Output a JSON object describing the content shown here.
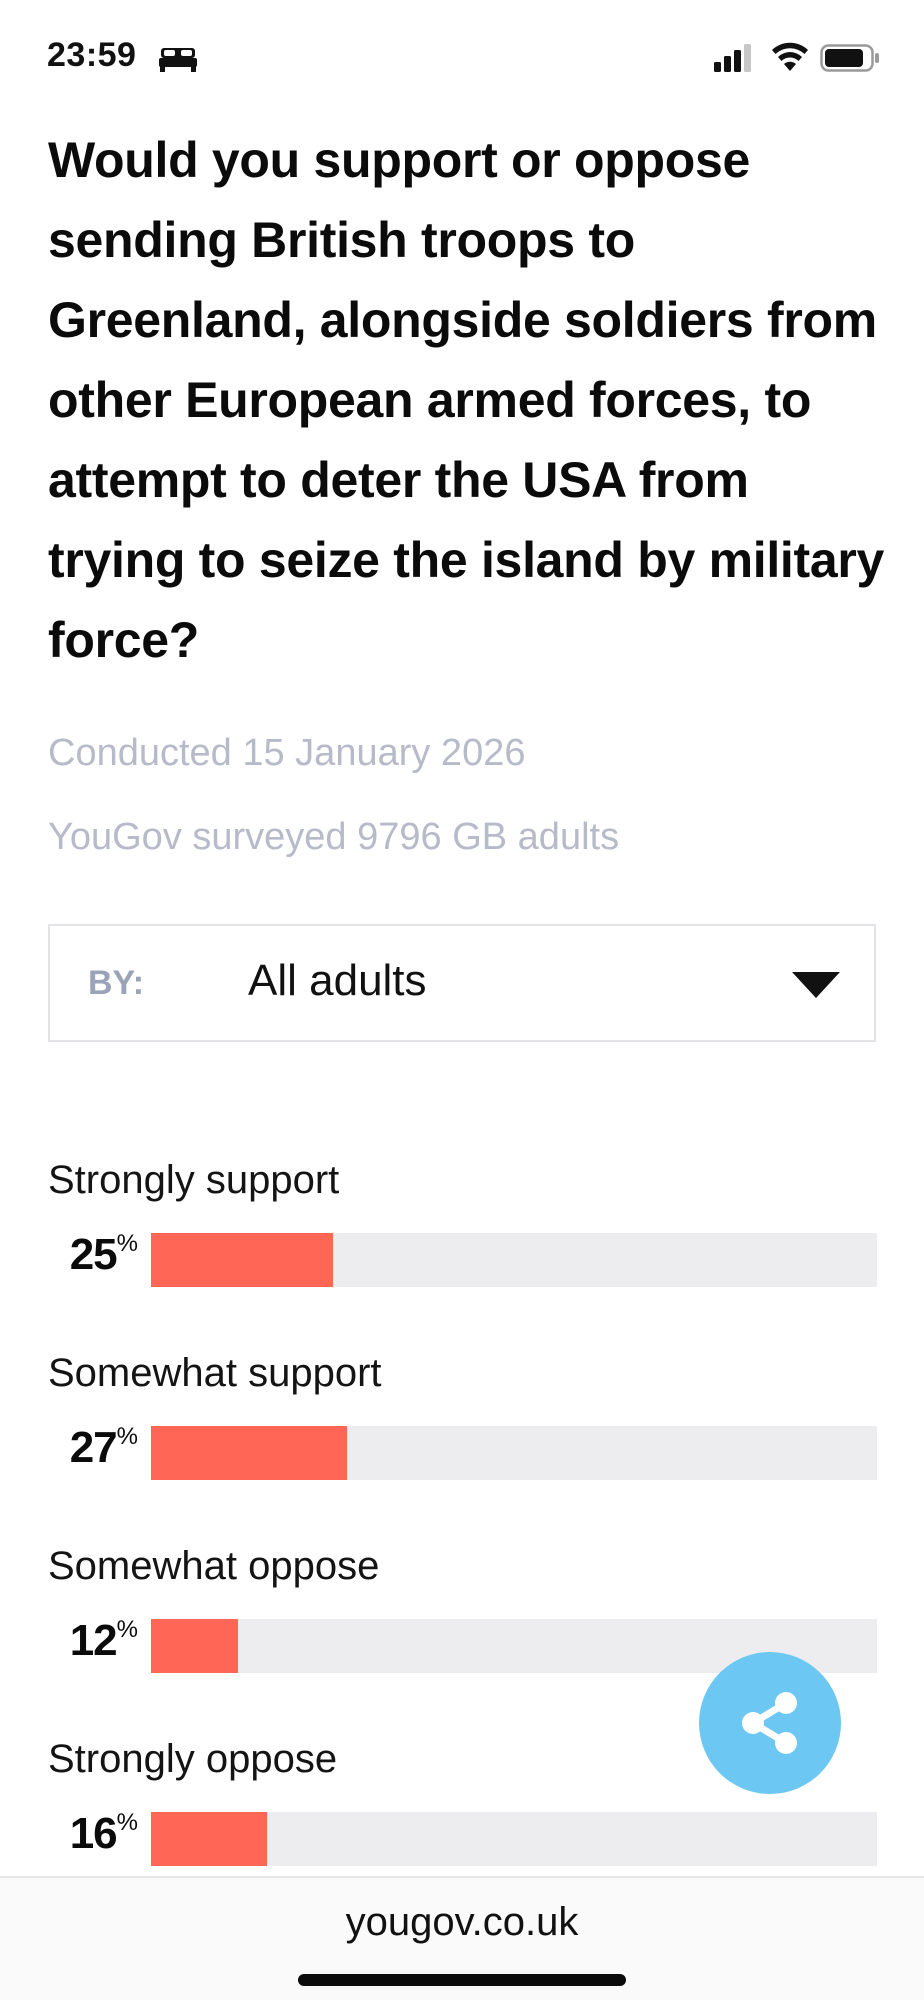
{
  "status_bar": {
    "time": "23:59",
    "icons": [
      "bed-icon",
      "signal-icon",
      "wifi-icon",
      "battery-icon"
    ]
  },
  "question": "Would you support or oppose sending British troops to Greenland, alongside soldiers from other European armed forces, to attempt to deter the USA from trying to seize the island by military force?",
  "conducted": "Conducted 15 January 2026",
  "sample": "YouGov surveyed 9796 GB adults",
  "filter": {
    "label": "BY:",
    "selected": "All adults",
    "icon": "caret-down-icon"
  },
  "chart_data": {
    "type": "bar",
    "categories": [
      "Strongly support",
      "Somewhat support",
      "Somewhat oppose",
      "Strongly oppose"
    ],
    "values": [
      25,
      27,
      12,
      16
    ],
    "unit": "%",
    "ylim": [
      0,
      100
    ],
    "bar_color": "#ff6655",
    "track_color": "#ededf0"
  },
  "share_button": {
    "icon": "share-icon",
    "color": "#6cc7f3"
  },
  "url_bar": {
    "url": "yougov.co.uk"
  }
}
